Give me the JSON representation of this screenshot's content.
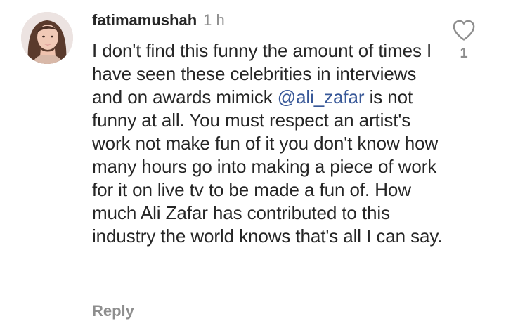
{
  "comment": {
    "username": "fatimamushah",
    "timestamp": "1 h",
    "text_before_mention": "I don't find this funny the amount of times I have seen these celebrities in interviews and on awards mimick ",
    "mention": "@ali_zafar",
    "text_after_mention": " is not funny at all. You must respect an artist's work not make fun of it you don't know how many hours go into making a piece of work for it on live tv to be made a fun of. How much Ali Zafar has contributed to this industry the world knows that's all I can say.",
    "reply_label": "Reply",
    "like_count": "1",
    "like_icon": "heart-outline-icon"
  },
  "colors": {
    "text": "#262626",
    "muted": "#8e8e8e",
    "mention": "#385898",
    "background": "#ffffff"
  }
}
